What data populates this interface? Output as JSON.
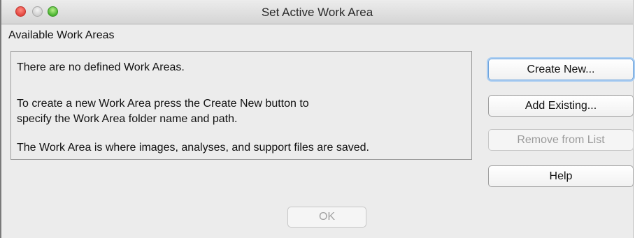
{
  "window": {
    "title": "Set Active Work Area"
  },
  "section_label": "Available Work Areas",
  "info": {
    "line1": "There are no defined Work Areas.",
    "line2": "To create a new Work Area press the Create New button to",
    "line3": "specify the Work Area folder name and path.",
    "line4": "The Work Area is where images, analyses, and support files are saved."
  },
  "buttons": {
    "create_new": "Create New...",
    "add_existing": "Add Existing...",
    "remove_from_list": "Remove from List",
    "help": "Help",
    "ok": "OK"
  },
  "states": {
    "remove_from_list_enabled": false,
    "ok_enabled": false,
    "create_new_focused": true
  },
  "colors": {
    "close": "#e2463f",
    "minimize": "#cfcfcf",
    "zoom": "#49b32f",
    "focus_ring": "#a9cdf2"
  },
  "icons": {
    "close": "close-icon",
    "minimize": "minimize-icon",
    "zoom": "zoom-icon"
  }
}
